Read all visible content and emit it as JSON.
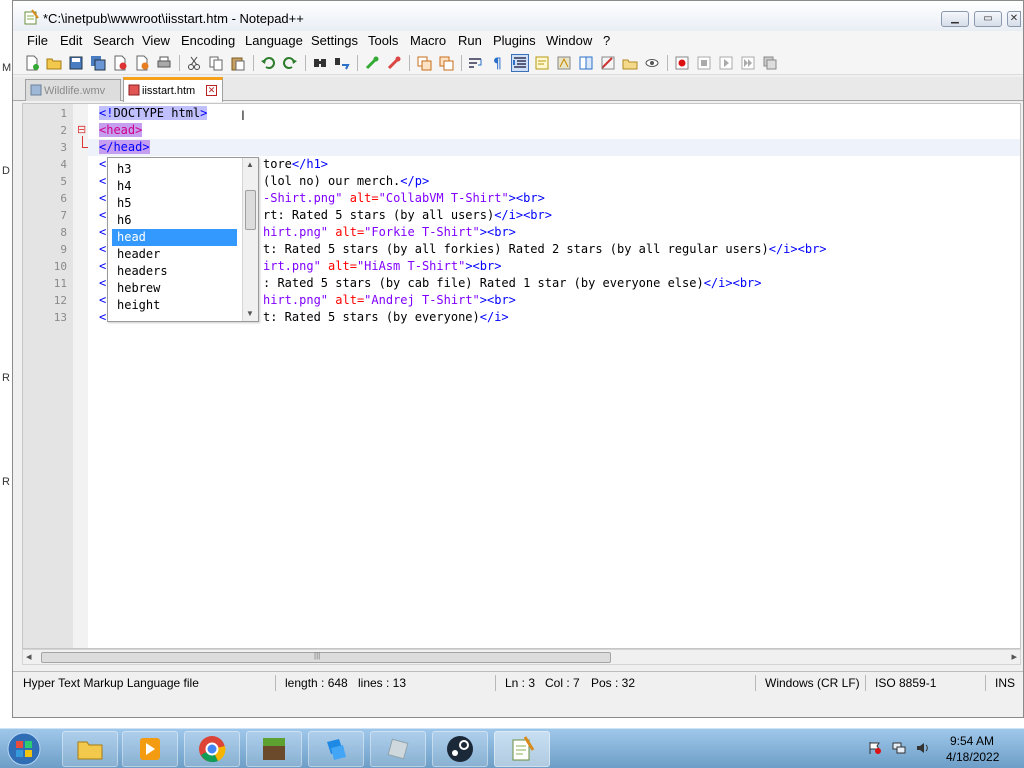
{
  "window": {
    "title": "*C:\\inetpub\\wwwroot\\iisstart.htm - Notepad++",
    "minimize_glyph": "▁",
    "maximize_glyph": "▭",
    "close_glyph": "✕"
  },
  "desktop_edge_letters": [
    "M",
    "D",
    "R",
    "R"
  ],
  "menu": [
    "File",
    "Edit",
    "Search",
    "View",
    "Encoding",
    "Language",
    "Settings",
    "Tools",
    "Macro",
    "Run",
    "Plugins",
    "Window",
    "?"
  ],
  "toolbar": {
    "icons": [
      "new-file-icon",
      "open-file-icon",
      "save-icon",
      "save-all-icon",
      "close-icon",
      "close-all-icon",
      "print-icon",
      "cut-icon",
      "copy-icon",
      "paste-icon",
      "undo-icon",
      "redo-icon",
      "find-icon",
      "replace-icon",
      "zoom-in-icon",
      "zoom-out-icon",
      "sync-vertical-icon",
      "sync-horizontal-icon",
      "word-wrap-icon",
      "show-all-chars-icon",
      "indent-guide-icon",
      "user-lang-icon",
      "doc-map-icon",
      "function-list-icon",
      "folder-workspace-icon",
      "monitor-icon",
      "record-macro-icon",
      "stop-record-icon",
      "play-macro-icon",
      "run-macro-icon",
      "save-macro-icon"
    ]
  },
  "tabs": [
    {
      "label": "Wildlife.wmv",
      "active": false
    },
    {
      "label": "iisstart.htm",
      "active": true
    }
  ],
  "editor": {
    "line_numbers": [
      "1",
      "2",
      "3",
      "4",
      "5",
      "6",
      "7",
      "8",
      "9",
      "10",
      "11",
      "12",
      "13"
    ],
    "lines": {
      "l1_open": "<!",
      "l1_name": "DOCTYPE html",
      "l1_close": ">",
      "l2_tag": "<head>",
      "l3_tag": "</head>",
      "l4_pre": "<",
      "l4_text": "tore",
      "l4_tag": "</h1>",
      "l5_pre": "<",
      "l5_text": "(lol no) our merch.",
      "l5_tag": "</p>",
      "l6_pre": "<",
      "l6_str1": "-Shirt.png\"",
      "l6_attr": "alt=",
      "l6_str2": "\"CollabVM T-Shirt\"",
      "l6_tag": "><br>",
      "l7_pre": "<",
      "l7_text": "rt: Rated 5 stars (by all users)",
      "l7_tag": "</i><br>",
      "l8_pre": "<",
      "l8_str1": "hirt.png\"",
      "l8_attr": "alt=",
      "l8_str2": "\"Forkie T-Shirt\"",
      "l8_tag": "><br>",
      "l9_pre": "<",
      "l9_text": "t: Rated 5 stars (by all forkies) Rated 2 stars (by all regular users)",
      "l9_tag": "</i><br>",
      "l10_pre": "<",
      "l10_str1": "irt.png\"",
      "l10_attr": "alt=",
      "l10_str2": "\"HiAsm T-Shirt\"",
      "l10_tag": "><br>",
      "l11_pre": "<",
      "l11_text": ": Rated 5 stars (by cab file) Rated 1 star (by everyone else)",
      "l11_tag": "</i><br>",
      "l12_pre": "<",
      "l12_str1": "hirt.png\"",
      "l12_attr": "alt=",
      "l12_str2": "\"Andrej T-Shirt\"",
      "l12_tag": "><br>",
      "l13_pre": "<",
      "l13_text": "t: Rated 5 stars (by everyone)",
      "l13_tag": "</i>"
    },
    "fold_glyph": "⊟"
  },
  "autocomplete": {
    "items": [
      "h3",
      "h4",
      "h5",
      "h6",
      "head",
      "header",
      "headers",
      "hebrew",
      "height"
    ],
    "selected": "head",
    "scroll_up": "▲",
    "scroll_down": "▼"
  },
  "hscroll": {
    "left": "◂",
    "right": "▸",
    "grip": "|||"
  },
  "status": {
    "file_type": "Hyper Text Markup Language file",
    "length": "length : 648",
    "lines": "lines : 13",
    "ln": "Ln : 3",
    "col": "Col : 7",
    "pos": "Pos : 32",
    "eol": "Windows (CR LF)",
    "encoding": "ISO 8859-1",
    "mode": "INS"
  },
  "taskbar": {
    "apps": [
      "explorer-icon",
      "media-player-icon",
      "chrome-icon",
      "minecraft-icon",
      "roblox-studio-icon",
      "roblox-icon",
      "steam-icon",
      "notepad-plus-plus-icon"
    ],
    "time": "9:54 AM",
    "date": "4/18/2022"
  },
  "colors": {
    "tag": "#0000ff",
    "attr": "#ff0000",
    "string": "#8000ff",
    "selection": "#3399ff",
    "highlight": "#c0c0ff",
    "tab_accent": "#f7a11b"
  }
}
